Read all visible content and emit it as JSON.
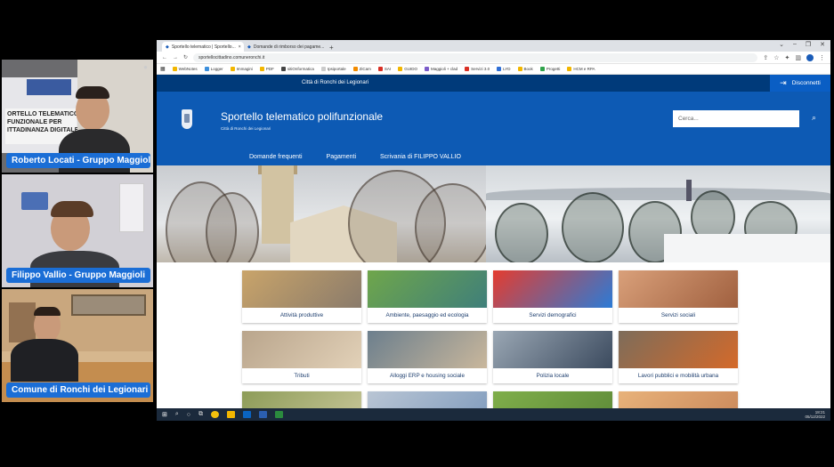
{
  "participants": [
    {
      "name": "Roberto Locati - Gruppo Maggioli",
      "background_text": "ORTELLO TELEMATICO\nFUNZIONALE PER\nITTADINANZA DIGITALE"
    },
    {
      "name": "Filippo Vallio - Gruppo Maggioli"
    },
    {
      "name": "Comune di Ronchi dei Legionari"
    }
  ],
  "browser": {
    "tabs": [
      {
        "label": "Sportello telematico | Sportello...",
        "close": "×"
      },
      {
        "label": "Domande di rimborso dei pagame...",
        "close": "×"
      }
    ],
    "new_tab": "+",
    "window_controls": [
      "⌄",
      "–",
      "❐",
      "✕"
    ],
    "url": "sportellocittadino.comuneronchi.it",
    "bookmarks": [
      "WebNotes",
      "Logger",
      "Immagini",
      "PDF",
      "sitiOnformatica",
      "Ipsiportale",
      "ZiCam",
      "SAI",
      "GUIDO",
      "Maggioli + clad",
      "Servizi 3.0",
      "LYD",
      "Book",
      "Progetti",
      "HCM e RPA"
    ]
  },
  "site": {
    "top_city": "Città di Ronchi dei Legionari",
    "logout_label": "Disconnetti",
    "title": "Sportello telematico polifunzionale",
    "subtitle": "Città di Ronchi dei Legionari",
    "search_placeholder": "Cerca...",
    "nav": [
      "Domande frequenti",
      "Pagamenti",
      "Scrivania di FILIPPO VALLIO"
    ],
    "cards": [
      {
        "label": "Attività produttive",
        "colors": [
          "#c9a46a",
          "#8a7b6b"
        ]
      },
      {
        "label": "Ambiente, paesaggio ed ecologia",
        "colors": [
          "#6fa64b",
          "#3f7f7a"
        ]
      },
      {
        "label": "Servizi demografici",
        "colors": [
          "#e43c2f",
          "#2c7bd6"
        ]
      },
      {
        "label": "Servizi sociali",
        "colors": [
          "#d9a07a",
          "#a0603f"
        ]
      },
      {
        "label": "Tributi",
        "colors": [
          "#b9a58c",
          "#e2d1b8"
        ]
      },
      {
        "label": "Alloggi ERP e housing sociale",
        "colors": [
          "#6c7f8d",
          "#c9b79c"
        ]
      },
      {
        "label": "Polizia locale",
        "colors": [
          "#9aa7b4",
          "#3b4a5e"
        ]
      },
      {
        "label": "Lavori pubblici e mobilità urbana",
        "colors": [
          "#7d6c5a",
          "#d46a2a"
        ]
      },
      {
        "label": "",
        "colors": [
          "#8d9c58",
          "#c9c79a"
        ]
      },
      {
        "label": "",
        "colors": [
          "#b9c5d4",
          "#7f9bbd"
        ]
      },
      {
        "label": "",
        "colors": [
          "#7fae4a",
          "#5e8a39"
        ]
      },
      {
        "label": "",
        "colors": [
          "#e8b27a",
          "#c9875a"
        ]
      }
    ]
  },
  "taskbar": {
    "time": "18:21",
    "date": "05/12/2022"
  }
}
